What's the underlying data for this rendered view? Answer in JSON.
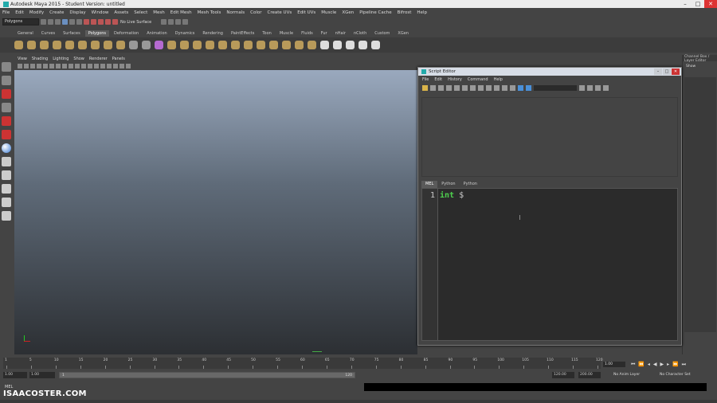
{
  "window": {
    "title": "Autodesk Maya 2015 - Student Version: untitled",
    "controls": [
      "–",
      "□",
      "✕"
    ]
  },
  "menubar": [
    "File",
    "Edit",
    "Modify",
    "Create",
    "Display",
    "Window",
    "Assets",
    "Select",
    "Mesh",
    "Edit Mesh",
    "Mesh Tools",
    "Normals",
    "Color",
    "Create UVs",
    "Edit UVs",
    "Muscle",
    "XGen",
    "Pipeline Cache",
    "Bifrost",
    "Help"
  ],
  "statusline": {
    "mode": "Polygons",
    "live_surface": "No Live Surface"
  },
  "shelf_tabs": [
    "General",
    "Curves",
    "Surfaces",
    "Polygons",
    "Deformation",
    "Animation",
    "Dynamics",
    "Rendering",
    "PaintEffects",
    "Toon",
    "Muscle",
    "Fluids",
    "Fur",
    "nHair",
    "nCloth",
    "Custom",
    "XGen"
  ],
  "shelf_active": "Polygons",
  "viewport_menu": [
    "View",
    "Shading",
    "Lighting",
    "Show",
    "Renderer",
    "Panels"
  ],
  "channel_box": {
    "title": "Channel Box / Layer Editor",
    "show_label": "Show"
  },
  "script_editor": {
    "title": "Script Editor",
    "menu": [
      "File",
      "Edit",
      "History",
      "Command",
      "Help"
    ],
    "tabs": [
      "MEL",
      "Python",
      "Python"
    ],
    "active_tab": "MEL",
    "line_number": "1",
    "code_keyword": "int",
    "code_rest": " $"
  },
  "timeline": {
    "ticks": [
      "1",
      "5",
      "10",
      "15",
      "20",
      "25",
      "30",
      "35",
      "40",
      "45",
      "50",
      "55",
      "60",
      "65",
      "70",
      "75",
      "80",
      "85",
      "90",
      "95",
      "100",
      "105",
      "110",
      "115",
      "120"
    ],
    "current_frame": "1.00"
  },
  "range": {
    "start": "1.00",
    "anim_start": "1.00",
    "range_start": "1",
    "range_end": "120",
    "anim_end": "120.00",
    "end": "200.00",
    "anim_layer": "No Anim Layer",
    "char_set": "No Character Set"
  },
  "cmdline": {
    "label": "MEL"
  },
  "watermark": "ISAACOSTER.COM"
}
